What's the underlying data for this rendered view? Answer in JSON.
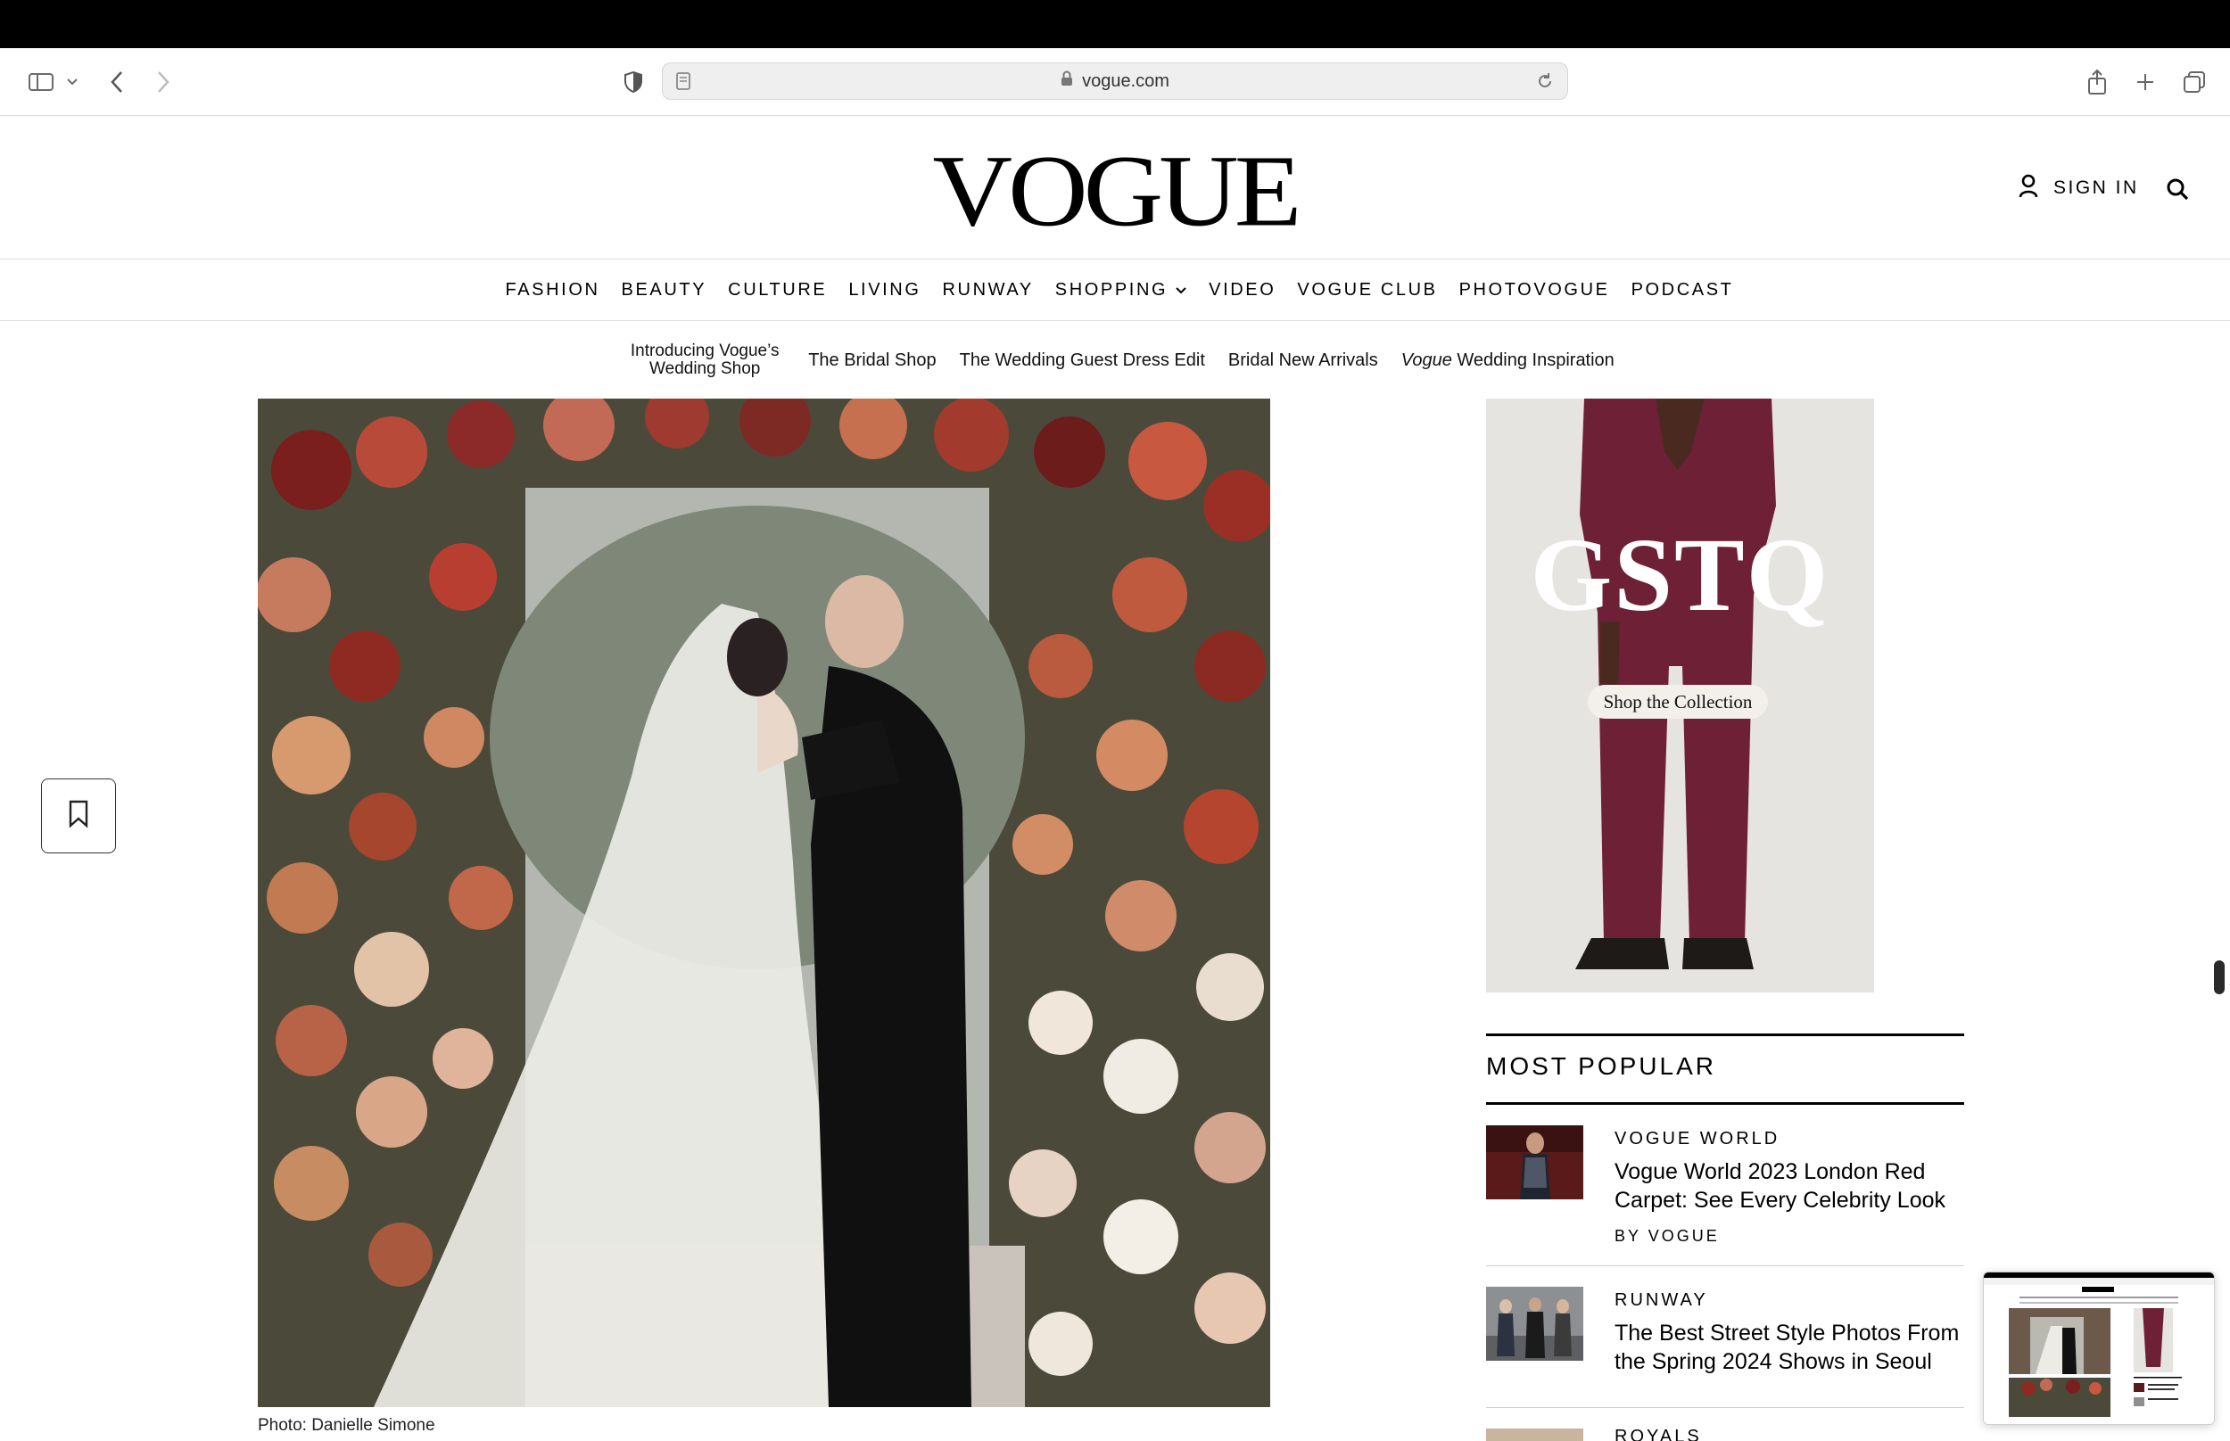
{
  "browser": {
    "url": "vogue.com"
  },
  "site": {
    "logo": "VOGUE",
    "sign_in": "SIGN IN"
  },
  "nav": {
    "items": [
      "FASHION",
      "BEAUTY",
      "CULTURE",
      "LIVING",
      "RUNWAY",
      "SHOPPING",
      "VIDEO",
      "VOGUE CLUB",
      "PHOTOVOGUE",
      "PODCAST"
    ]
  },
  "subnav": {
    "intro": "Introducing Vogue’s Wedding Shop",
    "bridal_shop": "The Bridal Shop",
    "guest_dress": "The Wedding Guest Dress Edit",
    "new_arrivals": "Bridal New Arrivals",
    "inspiration_brand": "Vogue",
    "inspiration_rest": " Wedding Inspiration"
  },
  "article": {
    "photo_caption": "Photo: Danielle Simone"
  },
  "ad": {
    "brand": "GSTQ",
    "cta": "Shop the Collection"
  },
  "most_popular": {
    "title": "MOST POPULAR",
    "items": [
      {
        "category": "VOGUE WORLD",
        "headline": "Vogue World 2023 London Red Carpet: See Every Celebrity Look",
        "byline": "BY VOGUE"
      },
      {
        "category": "RUNWAY",
        "headline": "The Best Street Style Photos From the Spring 2024 Shows in Seoul",
        "byline": ""
      },
      {
        "category": "ROYALS",
        "headline": "",
        "byline": ""
      }
    ]
  },
  "colors": {
    "ad_suit": "#6e2036",
    "text": "#000000",
    "divider": "#dedede"
  }
}
